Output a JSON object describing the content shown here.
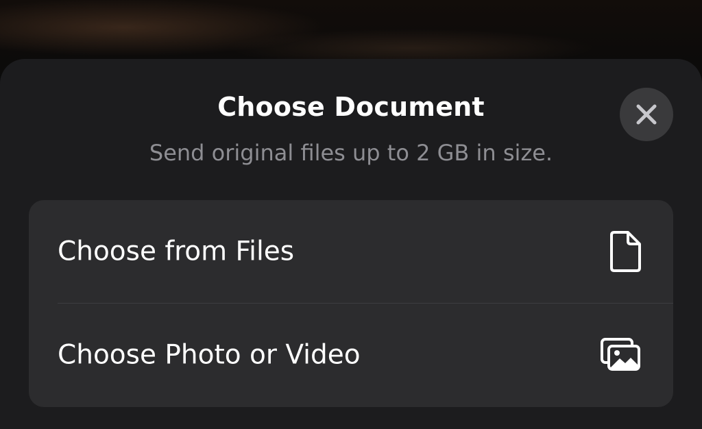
{
  "sheet": {
    "title": "Choose Document",
    "subtitle": "Send original files up to 2 GB in size.",
    "close_icon": "close-icon"
  },
  "options": [
    {
      "label": "Choose from Files",
      "icon": "document-icon"
    },
    {
      "label": "Choose Photo or Video",
      "icon": "photos-icon"
    }
  ],
  "colors": {
    "sheet_background": "#1c1c1e",
    "group_background": "#2c2c2e",
    "close_button_background": "#3a3a3c",
    "subtitle_text": "#8e8e93",
    "primary_text": "#ffffff"
  }
}
